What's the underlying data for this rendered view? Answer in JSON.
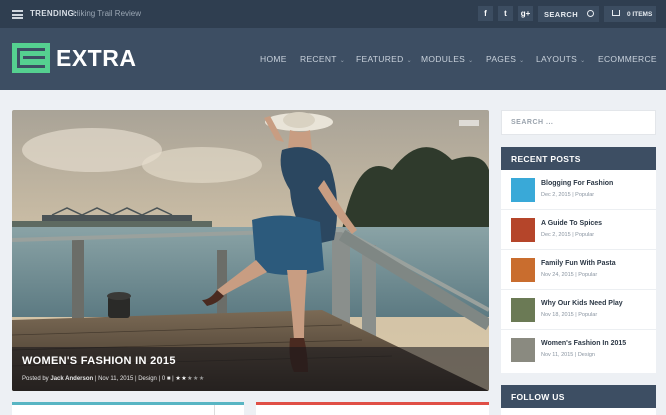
{
  "topbar": {
    "trending_label": "TRENDING:",
    "trending_link": "Hiking Trail Review",
    "social": [
      {
        "icon": "facebook-icon",
        "glyph": "f"
      },
      {
        "icon": "twitter-icon",
        "glyph": "t"
      },
      {
        "icon": "google-plus-icon",
        "glyph": "g+"
      }
    ],
    "search_label": "SEARCH",
    "cart_label": "0 ITEMS"
  },
  "header": {
    "logo_text": "EXTRA",
    "nav": [
      {
        "label": "HOME",
        "has_dropdown": false
      },
      {
        "label": "RECENT",
        "has_dropdown": true
      },
      {
        "label": "FEATURED",
        "has_dropdown": true
      },
      {
        "label": "MODULES",
        "has_dropdown": true
      },
      {
        "label": "PAGES",
        "has_dropdown": true
      },
      {
        "label": "LAYOUTS",
        "has_dropdown": true
      },
      {
        "label": "ECOMMERCE",
        "has_dropdown": false
      }
    ]
  },
  "hero": {
    "title": "WOMEN'S FASHION IN 2015",
    "posted_by_prefix": "Posted by",
    "author": "Jack Anderson",
    "date": "Nov 11, 2015",
    "category": "Design",
    "comments": "0",
    "rating": 2.5
  },
  "sidebar": {
    "search_placeholder": "SEARCH ...",
    "recent_title": "RECENT POSTS",
    "posts": [
      {
        "title": "Blogging For Fashion",
        "date": "Dec 2, 2015",
        "category": "Popular",
        "thumb_color": "#39a9d8"
      },
      {
        "title": "A Guide To Spices",
        "date": "Dec 2, 2015",
        "category": "Popular",
        "thumb_color": "#b5452a"
      },
      {
        "title": "Family Fun With Pasta",
        "date": "Nov 24, 2015",
        "category": "Popular",
        "thumb_color": "#c96d2e"
      },
      {
        "title": "Why Our Kids Need Play",
        "date": "Nov 18, 2015",
        "category": "Popular",
        "thumb_color": "#6b7a55"
      },
      {
        "title": "Women's Fashion In 2015",
        "date": "Nov 11, 2015",
        "category": "Design",
        "thumb_color": "#8a8a80"
      }
    ],
    "follow_title": "FOLLOW US"
  },
  "colors": {
    "topbar": "#2f3e50",
    "header": "#3d4e63",
    "logo_accent": "#55d090",
    "widget1_accent": "#58b5c3",
    "widget2_accent": "#e04f46"
  }
}
